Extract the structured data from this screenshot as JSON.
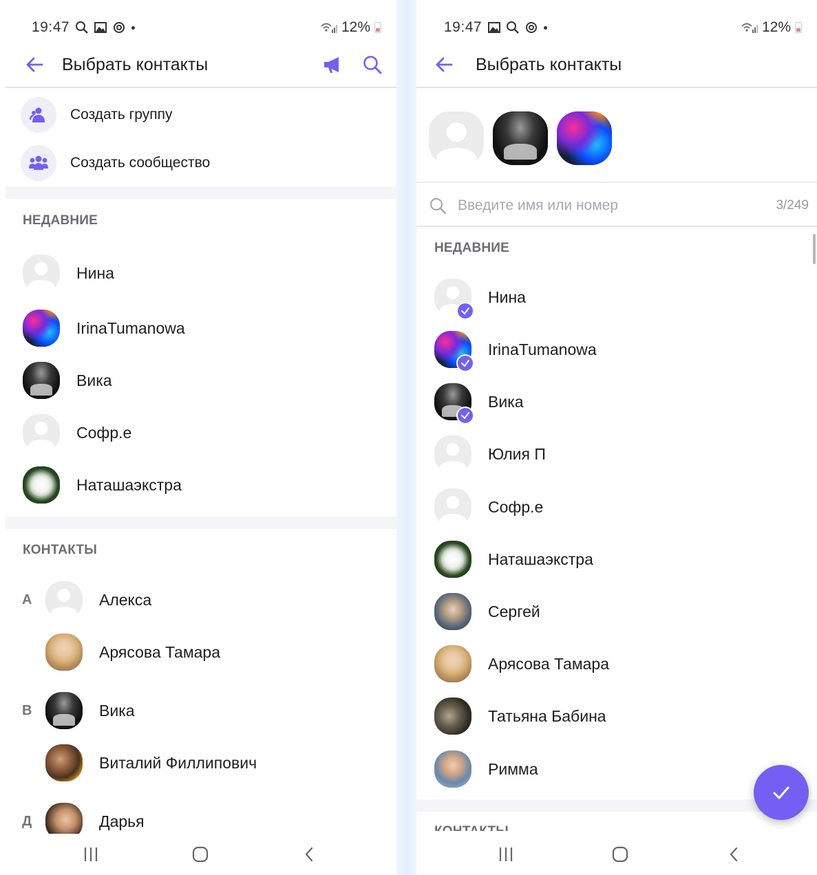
{
  "left": {
    "status": {
      "time": "19:47",
      "battery": "12%"
    },
    "header": {
      "title": "Выбрать контакты"
    },
    "actions": [
      {
        "label": "Создать группу",
        "icon": "group-icon"
      },
      {
        "label": "Создать сообщество",
        "icon": "community-icon"
      }
    ],
    "recent_header": "НЕДАВНИЕ",
    "recent": [
      {
        "name": "Нина",
        "avatar": "placeholder"
      },
      {
        "name": "IrinaTumanowa",
        "avatar": "irina"
      },
      {
        "name": "Вика",
        "avatar": "vika"
      },
      {
        "name": "Софр.е",
        "avatar": "placeholder"
      },
      {
        "name": "Наташаэкстра",
        "avatar": "natasha"
      }
    ],
    "contacts_header": "КОНТАКТЫ",
    "contacts": [
      {
        "letter": "А",
        "name": "Алекса",
        "avatar": "placeholder"
      },
      {
        "letter": "",
        "name": "Арясова Тамара",
        "avatar": "tamara"
      },
      {
        "letter": "В",
        "name": "Вика",
        "avatar": "vika"
      },
      {
        "letter": "",
        "name": "Виталий Филлипович",
        "avatar": "vitaly"
      },
      {
        "letter": "Д",
        "name": "Дарья",
        "avatar": "darya"
      }
    ]
  },
  "right": {
    "status": {
      "time": "19:47",
      "battery": "12%"
    },
    "header": {
      "title": "Выбрать контакты"
    },
    "selected_avatars": [
      "placeholder",
      "vika",
      "irina"
    ],
    "search": {
      "placeholder": "Введите имя или номер",
      "value": "",
      "count": "3/249"
    },
    "recent_header": "НЕДАВНИЕ",
    "recent": [
      {
        "name": "Нина",
        "avatar": "placeholder",
        "selected": true
      },
      {
        "name": "IrinaTumanowa",
        "avatar": "irina",
        "selected": true
      },
      {
        "name": "Вика",
        "avatar": "vika",
        "selected": true
      },
      {
        "name": "Юлия П",
        "avatar": "placeholder",
        "selected": false
      },
      {
        "name": "Софр.е",
        "avatar": "placeholder",
        "selected": false
      },
      {
        "name": "Наташаэкстра",
        "avatar": "natasha",
        "selected": false
      },
      {
        "name": "Сергей",
        "avatar": "sergey",
        "selected": false
      },
      {
        "name": "Арясова Тамара",
        "avatar": "tamara",
        "selected": false
      },
      {
        "name": "Татьяна Бабина",
        "avatar": "tatyana",
        "selected": false
      },
      {
        "name": "Римма",
        "avatar": "rimma",
        "selected": false
      }
    ],
    "contacts_header": "КОНТАКТЫ"
  },
  "colors": {
    "accent": "#7360f2",
    "section": "#6d6d72",
    "placeholder": "#ececec"
  },
  "icons": {
    "back": "arrow-left-icon",
    "broadcast": "megaphone-icon",
    "search": "search-icon",
    "confirm": "check-icon",
    "nav": [
      "recents-icon",
      "home-icon",
      "back-icon"
    ]
  }
}
